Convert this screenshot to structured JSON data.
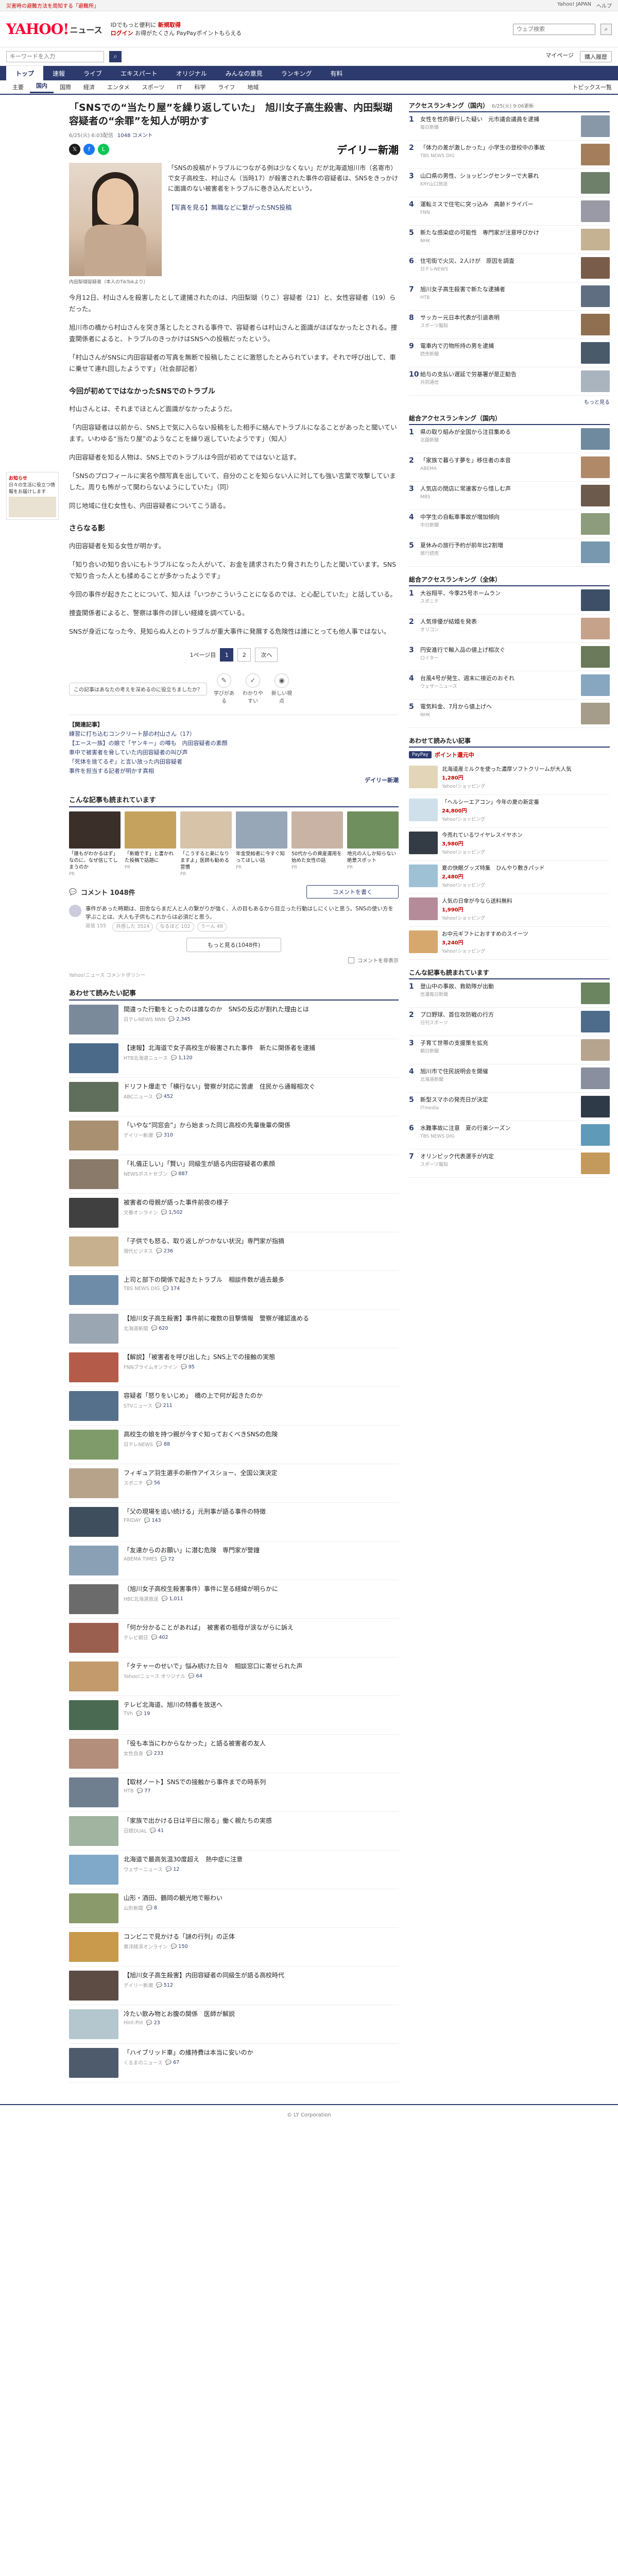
{
  "topstrip": {
    "alert": "災害時の避難方法を周知する「避難所」",
    "links": [
      "Yahoo! JAPAN",
      "ヘルプ"
    ]
  },
  "masthead": {
    "logo": "YAHOO!",
    "logo_sub": "ニュース",
    "links": [
      "IDでもっと便利に",
      "新規取得",
      "ログイン",
      "お得がたくさん",
      "PayPayポイントもらえる"
    ],
    "search_placeholder": "ウェブ検索"
  },
  "subbar": {
    "search_placeholder": "キーワードを入力",
    "links": [
      "マイページ",
      "購入履歴"
    ]
  },
  "mainnav": [
    "トップ",
    "速報",
    "ライブ",
    "エキスパート",
    "オリジナル",
    "みんなの意見",
    "ランキング",
    "有料"
  ],
  "mainnav_active": "トップ",
  "catnav": [
    "主要",
    "国内",
    "国際",
    "経済",
    "エンタメ",
    "スポーツ",
    "IT",
    "科学",
    "ライフ",
    "地域"
  ],
  "catnav_active": "国内",
  "catnav_more": "トピックス一覧",
  "left_promo": {
    "title": "お知らせ",
    "body": "日々の生活に役立つ情報をお届けします"
  },
  "article": {
    "title": "「SNSでの“当たり屋”を繰り返していた」　旭川女子高生殺害、内田梨瑚容疑者の“余罪”を知人が明かす",
    "date": "6/25(火) 6:03配信",
    "comments": "1048 コメント",
    "source_name": "デイリー新潮",
    "photo_caption": "内田梨瑚容疑者（本人のTikTokより）",
    "lead": "「SNSの投稿がトラブルにつながる例は少なくない」だが北海道旭川市（名寄市）で女子高校生、村山さん（当時17）が殺害された事件の容疑者は、SNSをきっかけに面識のない被害者をトラブルに巻き込んだという。",
    "lead_link": "【写真を見る】無職などに繋がったSNS投稿",
    "paragraphs": [
      "今月12日、村山さんを殺害したとして逮捕されたのは、内田梨瑚（りこ）容疑者（21）と、女性容疑者（19）らだった。",
      "旭川市の橋から村山さんを突き落としたとされる事件で、容疑者らは村山さんと面識がほぼなかったとされる。捜査関係者によると、トラブルのきっかけはSNSへの投稿だったという。",
      "「村山さんがSNSに内田容疑者の写真を無断で投稿したことに激怒したとみられています。それで呼び出して、車に乗せて連れ回したようです」（社会部記者）"
    ],
    "h_sns": "今回が初めてではなかったSNSでのトラブル",
    "paragraphs2": [
      "村山さんとは、それまでほとんど面識がなかったようだ。",
      "「内田容疑者は以前から、SNS上で気に入らない投稿をした相手に絡んでトラブルになることがあったと聞いています。いわゆる“当たり屋”のようなことを繰り返していたようです」（知人）",
      "内田容疑者を知る人物は、SNS上でのトラブルは今回が初めてではないと話す。",
      "「SNSのプロフィールに実名や顔写真を出していて、自分のことを知らない人に対しても強い言葉で攻撃していました。周りも怖がって関わらないようにしていた」（同）",
      "同じ地域に住む女性も、内田容疑者についてこう語る。"
    ],
    "h_third": "さらなる影",
    "paragraphs3": [
      "内田容疑者を知る女性が明かす。",
      "「知り合いの知り合いにもトラブルになった人がいて、お金を請求されたり脅されたりしたと聞いています。SNSで知り合った人とも揉めることが多かったようです」",
      "今回の事件が起きたことについて、知人は「いつかこういうことになるのでは、と心配していた」と話している。",
      "捜査関係者によると、警察は事件の詳しい経緯を調べている。",
      "SNSが身近になった今、見知らぬ人とのトラブルが重大事件に発展する危険性は誰にとっても他人事ではない。"
    ],
    "pager": {
      "label_page": "1ページ目",
      "pages": [
        "1",
        "2"
      ],
      "next": "次へ"
    },
    "reactions_tip": "この記事はあなたの考えを深めるのに役立ちましたか？",
    "reactions": [
      "学びがある",
      "わかりやすい",
      "新しい視点"
    ],
    "related_label": "【関連記事】",
    "related": [
      "練習に打ち込むコンクリート部の村山さん（17）",
      "【エース一族】の娘で「ヤンキー」の噂も　内田容疑者の素顔",
      "車中で被害者を脅していた内田容疑者の叫び声",
      "「死体を捨てるぞ」と言い放った内田容疑者",
      "事件を担当する記者が明かす真相"
    ],
    "related_source": "デイリー新潮"
  },
  "recs_title": "こんな記事も読まれています",
  "recs": [
    {
      "title": "「誰もがわかるはず」なのに、なぜ信じてしまうのか",
      "src": "PR",
      "color": "#3b2f2a"
    },
    {
      "title": "「新婚です」と書かれた投稿で話題に",
      "src": "PR",
      "color": "#c5a35f"
    },
    {
      "title": "「こうすると楽になりますよ」医師も勧める習慣",
      "src": "PR",
      "color": "#d7c3a8"
    },
    {
      "title": "年金受給者に今すぐ知ってほしい話",
      "src": "PR",
      "color": "#98a7b8"
    },
    {
      "title": "50代からの資産運用を始めた女性の話",
      "src": "PR",
      "color": "#c9b3a4"
    },
    {
      "title": "地元の人しか知らない絶景スポット",
      "src": "PR",
      "color": "#6f8f5e"
    }
  ],
  "comments": {
    "count_label": "コメント 1048件",
    "write_button": "コメントを書く",
    "first": "事件があった時期は、田舎ならまだ人と人の繋がりが強く、人の目もあるから目立った行動はしにくいと思う。SNSの使い方を学ぶことは、大人も子供もこれからは必須だと思う。",
    "first_meta": "返信 155",
    "votes": [
      "共感した 3524",
      "なるほど 102",
      "うーん 48"
    ],
    "more": "もっと見る(1048件)",
    "option": "コメントを非表示",
    "note": "Yahoo!ニュース コメントポリシー"
  },
  "feed_title": "あわせて読みたい記事",
  "feed": [
    {
      "title": "間違った行動をとったのは誰なのか　SNSの反応が割れた理由とは",
      "src": "日テレNEWS NNN",
      "cc": "2,345",
      "color": "#7a8a9a"
    },
    {
      "title": "【速報】北海道で女子高校生が殺害された事件　新たに関係者を逮捕",
      "src": "HTB北海道ニュース",
      "cc": "1,120",
      "color": "#4b6a8a"
    },
    {
      "title": "ドリフト爆走で「横行ない」警察が対応に苦慮　住民から通報相次ぐ",
      "src": "ABCニュース",
      "cc": "452",
      "color": "#5f6f5b"
    },
    {
      "title": "「いやな“同窓会”」から始まった同じ高校の先輩後輩の関係",
      "src": "デイリー新潮",
      "cc": "310",
      "color": "#a89070"
    },
    {
      "title": "「礼儀正しい」「賢い」同級生が語る内田容疑者の素顔",
      "src": "NEWSポストセブン",
      "cc": "887",
      "color": "#8a7a6a"
    },
    {
      "title": "被害者の母親が語った事件前夜の様子",
      "src": "文春オンライン",
      "cc": "1,502",
      "color": "#404040"
    },
    {
      "title": "「子供でも怒る、取り返しがつかない状況」専門家が指摘",
      "src": "現代ビジネス",
      "cc": "236",
      "color": "#c7b08d"
    },
    {
      "title": "上司と部下の関係で起きたトラブル　相談件数が過去最多",
      "src": "TBS NEWS DIG",
      "cc": "174",
      "color": "#6e8ca8"
    },
    {
      "title": "【旭川女子高生殺害】事件前に複数の目撃情報　警察が確認進める",
      "src": "北海道新聞",
      "cc": "620",
      "color": "#9aa6b2"
    },
    {
      "title": "【解説】「被害者を呼び出した」SNS上での接触の実態",
      "src": "FNNプライムオンライン",
      "cc": "95",
      "color": "#b45b4a"
    },
    {
      "title": "容疑者「怒りをいじめ」　橋の上で何が起きたのか",
      "src": "STVニュース",
      "cc": "211",
      "color": "#55708a"
    },
    {
      "title": "高校生の娘を持つ親が今すぐ知っておくべきSNSの危険",
      "src": "日テレNEWS",
      "cc": "88",
      "color": "#7f9b6a"
    },
    {
      "title": "フィギュア羽生選手の新作アイスショー、全国公演決定",
      "src": "スポニチ",
      "cc": "56",
      "color": "#b6a38a"
    },
    {
      "title": "「父の現場を追い続ける」元刑事が語る事件の特徴",
      "src": "FRIDAY",
      "cc": "143",
      "color": "#3f4e5c"
    },
    {
      "title": "「友達からのお願い」に潜む危険　専門家が警鐘",
      "src": "ABEMA TIMES",
      "cc": "72",
      "color": "#8aa1b5"
    },
    {
      "title": "（旭川女子高校生殺害事件）事件に至る経緯が明らかに",
      "src": "HBC北海道放送",
      "cc": "1,011",
      "color": "#6b6b6b"
    },
    {
      "title": "「何か分かることがあれば」　被害者の祖母が涙ながらに訴え",
      "src": "テレビ朝日",
      "cc": "402",
      "color": "#9a5f4f"
    },
    {
      "title": "「タテャーのせいで」悩み続けた日々　相談窓口に寄せられた声",
      "src": "Yahoo!ニュース オリジナル",
      "cc": "64",
      "color": "#c29a6b"
    },
    {
      "title": "テレビ北海道、旭川の特番を放送へ",
      "src": "TVh",
      "cc": "19",
      "color": "#4a6b52"
    },
    {
      "title": "「役も本当にわからなかった」と語る被害者の友人",
      "src": "女性自身",
      "cc": "233",
      "color": "#b38e7a"
    },
    {
      "title": "【取材ノート】SNSでの接触から事件までの時系列",
      "src": "HTB",
      "cc": "77",
      "color": "#6f7f8f"
    },
    {
      "title": "「家族で出かける日は平日に限る」働く親たちの実感",
      "src": "日経DUAL",
      "cc": "41",
      "color": "#a0b4a0"
    },
    {
      "title": "北海道で最高気温30度超え　熱中症に注意",
      "src": "ウェザーニュース",
      "cc": "12",
      "color": "#7fa8c9"
    },
    {
      "title": "山形・酒田、鶴岡の観光地で賑わい",
      "src": "山形新聞",
      "cc": "8",
      "color": "#8a9a6a"
    },
    {
      "title": "コンビニで見かける「謎の行列」の正体",
      "src": "東洋経済オンライン",
      "cc": "150",
      "color": "#c99a4b"
    },
    {
      "title": "【旭川女子高生殺害】内田容疑者の同級生が語る高校時代",
      "src": "デイリー新潮",
      "cc": "512",
      "color": "#5c4c44"
    },
    {
      "title": "冷たい飲み物とお腹の関係　医師が解説",
      "src": "Hint-Pot",
      "cc": "23",
      "color": "#b4c7cf"
    },
    {
      "title": "「ハイブリッド車」の維持費は本当に安いのか",
      "src": "くるまのニュース",
      "cc": "67",
      "color": "#4e5b6c"
    }
  ],
  "side": {
    "ranking_title": "アクセスランキング（国内）",
    "ranking_sub": "6/25(火) 9:06更新",
    "ranking": [
      {
        "text": "女性を性的暴行した疑い　元市議会議員を逮捕",
        "src": "毎日新聞",
        "color": "#8898a8"
      },
      {
        "text": "「体力の差が激しかった」小学生の登校中の事故",
        "src": "TBS NEWS DIG",
        "color": "#a47e5c"
      },
      {
        "text": "山口県の男性、ショッピングセンターで大暴れ",
        "src": "KRY山口放送",
        "color": "#6e7f6a"
      },
      {
        "text": "運転ミスで住宅に突っ込み　高齢ドライバー",
        "src": "FNN",
        "color": "#9a9aa6"
      },
      {
        "text": "新たな感染症の可能性　専門家が注意呼びかけ",
        "src": "NHK",
        "color": "#c4b292"
      },
      {
        "text": "住宅街で火災、2人けが　原因を調査",
        "src": "日テレNEWS",
        "color": "#7a5c4a"
      },
      {
        "text": "旭川女子高生殺害で新たな逮捕者",
        "src": "HTB",
        "color": "#5f6e80"
      },
      {
        "text": "サッカー元日本代表が引退表明",
        "src": "スポーツ報知",
        "color": "#8f6f4f"
      },
      {
        "text": "電車内で刃物所持の男を逮捕",
        "src": "読売新聞",
        "color": "#495a6b"
      },
      {
        "text": "給与の支払い遅延で労基署が是正勧告",
        "src": "共同通信",
        "color": "#aab4be"
      }
    ],
    "ranking_more": "もっと見る",
    "ranking2_title": "総合アクセスランキング（国内）",
    "ranking2": [
      {
        "text": "県の取り組みが全国から注目集める",
        "src": "北國新聞",
        "color": "#6f8a9e"
      },
      {
        "text": "「家族で暮らす夢を」移住者の本音",
        "src": "ABEMA",
        "color": "#b08968"
      },
      {
        "text": "人気店の閉店に常連客から惜しむ声",
        "src": "MBS",
        "color": "#6c5a4c"
      },
      {
        "text": "中学生の自転車事故が増加傾向",
        "src": "中日新聞",
        "color": "#8c9c7c"
      },
      {
        "text": "夏休みの旅行予約が前年比2割増",
        "src": "旅行読売",
        "color": "#7898b0"
      }
    ],
    "ranking3_title": "総合アクセスランキング（全体）",
    "ranking3": [
      {
        "text": "大谷翔平、今季25号ホームラン",
        "src": "スポニチ",
        "color": "#3d4f66"
      },
      {
        "text": "人気俳優が結婚を発表",
        "src": "オリコン",
        "color": "#c7a28a"
      },
      {
        "text": "円安進行で輸入品の値上げ相次ぐ",
        "src": "ロイター",
        "color": "#6a7a5a"
      },
      {
        "text": "台風4号が発生、週末に接近のおそれ",
        "src": "ウェザーニュース",
        "color": "#87a7c1"
      },
      {
        "text": "電気料金、7月から値上げへ",
        "src": "NHK",
        "color": "#a59c8a"
      }
    ],
    "ad_title": "あわせて読みたい記事",
    "ad_pick_badge": "PayPay",
    "ad_pick_text": "ポイント還元中",
    "ads": [
      {
        "text": "北海道産ミルクを使った濃厚ソフトクリームが大人気",
        "price": "1,280円",
        "label": "Yahoo!ショッピング",
        "color": "#e3d6b8"
      },
      {
        "text": "「ヘルシーエアコン」今年の夏の新定番",
        "price": "24,800円",
        "label": "Yahoo!ショッピング",
        "color": "#cfe0ea"
      },
      {
        "text": "今売れているワイヤレスイヤホン",
        "price": "3,980円",
        "label": "Yahoo!ショッピング",
        "color": "#333b45"
      },
      {
        "text": "夏の快眠グッズ特集　ひんやり敷きパッド",
        "price": "2,480円",
        "label": "Yahoo!ショッピング",
        "color": "#9fc1d6"
      },
      {
        "text": "人気の日傘が今なら送料無料",
        "price": "1,990円",
        "label": "Yahoo!ショッピング",
        "color": "#b58b9a"
      },
      {
        "text": "お中元ギフトにおすすめのスイーツ",
        "price": "3,240円",
        "label": "Yahoo!ショッピング",
        "color": "#d7a86e"
      }
    ],
    "ranking4_title": "こんな記事も読まれています",
    "ranking4": [
      {
        "text": "登山中の事故、救助隊が出動",
        "src": "信濃毎日新聞",
        "color": "#6a8560"
      },
      {
        "text": "プロ野球、首位攻防戦の行方",
        "src": "日刊スポーツ",
        "color": "#4d6b8a"
      },
      {
        "text": "子育て世帯の支援策を拡充",
        "src": "朝日新聞",
        "color": "#b7a48f"
      },
      {
        "text": "旭川市で住民説明会を開催",
        "src": "北海道新聞",
        "color": "#8a8fa0"
      },
      {
        "text": "新型スマホの発売日が決定",
        "src": "ITmedia",
        "color": "#2f3a48"
      },
      {
        "text": "水難事故に注意　夏の行楽シーズン",
        "src": "TBS NEWS DIG",
        "color": "#5f9ab8"
      },
      {
        "text": "オリンピック代表選手が内定",
        "src": "スポーツ報知",
        "color": "#c49a5c"
      }
    ]
  },
  "footer": "© LY Corporation"
}
